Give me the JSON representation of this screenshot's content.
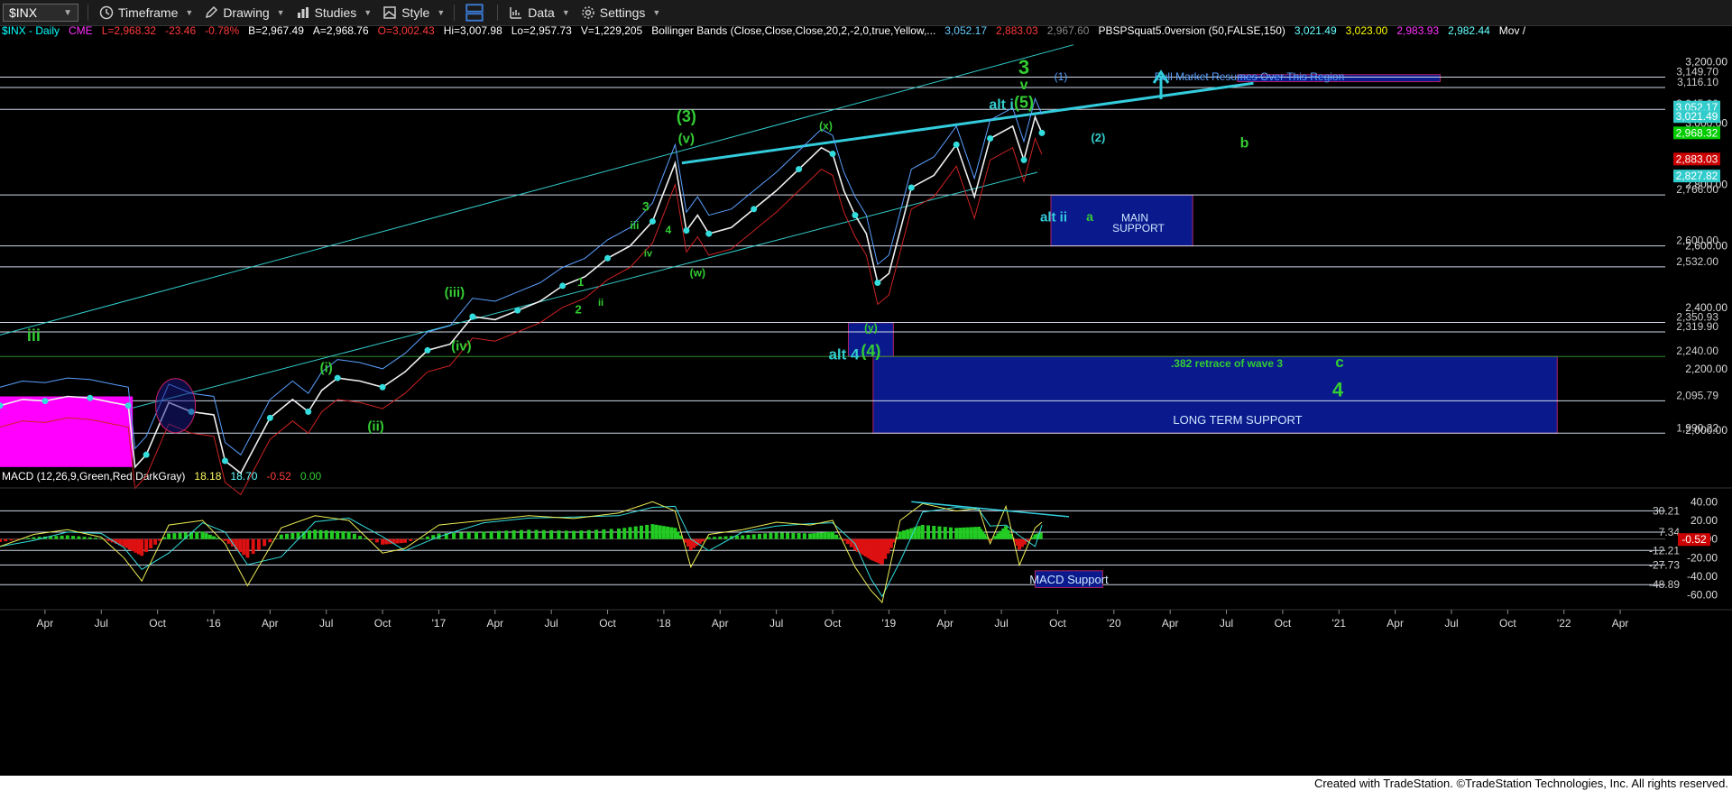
{
  "toolbar": {
    "symbol": "$INX",
    "items": [
      "Timeframe",
      "Drawing",
      "Studies",
      "Style",
      "Data",
      "Settings"
    ]
  },
  "header": {
    "main": [
      {
        "t": "$INX - Daily",
        "c": "#00ffff"
      },
      {
        "t": "CME",
        "c": "#ff33ff"
      },
      {
        "t": "L=2,968.32",
        "c": "#ff3b3b"
      },
      {
        "t": "-23.46",
        "c": "#ff3b3b"
      },
      {
        "t": "-0.78%",
        "c": "#ff3b3b"
      },
      {
        "t": "B=2,967.49",
        "c": "#ffffff"
      },
      {
        "t": "A=2,968.76",
        "c": "#ffffff"
      },
      {
        "t": "O=3,002.43",
        "c": "#ff3b3b"
      },
      {
        "t": "Hi=3,007.98",
        "c": "#ffffff"
      },
      {
        "t": "Lo=2,957.73",
        "c": "#ffffff"
      },
      {
        "t": "V=1,229,205",
        "c": "#ffffff"
      },
      {
        "t": "Bollinger Bands (Close,Close,Close,20,2,-2,0,true,Yellow,...",
        "c": "#ffffff"
      },
      {
        "t": "3,052.17",
        "c": "#66ccff"
      },
      {
        "t": "2,883.03",
        "c": "#ff3b3b"
      },
      {
        "t": "2,967.60",
        "c": "#888888"
      },
      {
        "t": "PBSPSquat5.0version (50,FALSE,150)",
        "c": "#ffffff"
      },
      {
        "t": "3,021.49",
        "c": "#66ffff"
      },
      {
        "t": "3,023.00",
        "c": "#ffff00"
      },
      {
        "t": "2,983.93",
        "c": "#ff33ff"
      },
      {
        "t": "2,982.44",
        "c": "#66ffff"
      },
      {
        "t": "Mov /",
        "c": "#ffffff"
      }
    ],
    "macd": [
      {
        "t": "MACD (12,26,9,Green,Red,DarkGray)",
        "c": "#ffffff"
      },
      {
        "t": "18.18",
        "c": "#ffff66"
      },
      {
        "t": "18.70",
        "c": "#66ffff"
      },
      {
        "t": "-0.52",
        "c": "#ff3b3b"
      },
      {
        "t": "0.00",
        "c": "#33cc33"
      }
    ]
  },
  "chart_data": [
    {
      "type": "line",
      "name": "$INX - Daily",
      "ylim": [
        1850,
        3260
      ],
      "y_ticks": [
        2000,
        2200,
        2400,
        2600,
        2800,
        3000,
        3200
      ],
      "y_tick_labels": [
        "2,000.00",
        "2,200.00",
        "2,400.00",
        "2,600.00",
        "2,800.00",
        "3,000.00",
        "3,200.00"
      ],
      "x_tick_labels": [
        "Apr",
        "Jul",
        "Oct",
        "'16",
        "Apr",
        "Jul",
        "Oct",
        "'17",
        "Apr",
        "Jul",
        "Oct",
        "'18",
        "Apr",
        "Jul",
        "Oct",
        "'19",
        "Apr",
        "Jul",
        "Oct",
        "'20",
        "Apr",
        "Jul",
        "Oct",
        "'21",
        "Apr",
        "Jul",
        "Oct",
        "'22",
        "Apr"
      ],
      "x_tick_times": [
        2015.25,
        2015.5,
        2015.75,
        2016.0,
        2016.25,
        2016.5,
        2016.75,
        2017.0,
        2017.25,
        2017.5,
        2017.75,
        2018.0,
        2018.25,
        2018.5,
        2018.75,
        2019.0,
        2019.25,
        2019.5,
        2019.75,
        2020.0,
        2020.25,
        2020.5,
        2020.75,
        2021.0,
        2021.25,
        2021.5,
        2021.75,
        2022.0,
        2022.25
      ],
      "x_range": [
        2015.05,
        2022.45
      ],
      "price_series": {
        "x": [
          2015.05,
          2015.15,
          2015.25,
          2015.35,
          2015.45,
          2015.55,
          2015.62,
          2015.65,
          2015.7,
          2015.8,
          2015.9,
          2016.0,
          2016.05,
          2016.12,
          2016.25,
          2016.35,
          2016.42,
          2016.48,
          2016.55,
          2016.65,
          2016.75,
          2016.85,
          2016.95,
          2017.05,
          2017.15,
          2017.25,
          2017.35,
          2017.45,
          2017.55,
          2017.65,
          2017.75,
          2017.85,
          2017.95,
          2018.05,
          2018.1,
          2018.15,
          2018.2,
          2018.3,
          2018.4,
          2018.5,
          2018.6,
          2018.7,
          2018.75,
          2018.8,
          2018.85,
          2018.9,
          2018.95,
          2019.0,
          2019.1,
          2019.2,
          2019.3,
          2019.38,
          2019.45,
          2019.55,
          2019.6,
          2019.65,
          2019.68
        ],
        "y": [
          2080,
          2100,
          2095,
          2110,
          2105,
          2090,
          2080,
          1880,
          1920,
          2090,
          2060,
          2050,
          1900,
          1860,
          2040,
          2100,
          2060,
          2130,
          2170,
          2160,
          2140,
          2190,
          2260,
          2280,
          2370,
          2360,
          2390,
          2420,
          2470,
          2500,
          2560,
          2600,
          2680,
          2870,
          2650,
          2700,
          2640,
          2660,
          2720,
          2780,
          2850,
          2920,
          2900,
          2780,
          2700,
          2640,
          2480,
          2510,
          2790,
          2830,
          2930,
          2760,
          2950,
          2990,
          2880,
          3020,
          2968
        ]
      },
      "horizontal_levels": [
        {
          "value": 3149.7,
          "label": "3,149.70"
        },
        {
          "value": 3116.1,
          "label": "3,116.10"
        },
        {
          "value": 3045.0,
          "label": "3,045.00"
        },
        {
          "value": 2766.0,
          "label": "2,766.00"
        },
        {
          "value": 2600.0,
          "label": "2,600.00"
        },
        {
          "value": 2532.0,
          "label": "2,532.00"
        },
        {
          "value": 2350.93,
          "label": "2,350.93"
        },
        {
          "value": 2319.9,
          "label": "2,319.90"
        },
        {
          "value": 2240.0,
          "label": "2,240.00"
        },
        {
          "value": 2095.79,
          "label": "2,095.79"
        },
        {
          "value": 1990.22,
          "label": "1,990.22"
        }
      ],
      "price_tags": [
        {
          "value": 3052.17,
          "label": "3,052.17",
          "color": "#33cccc"
        },
        {
          "value": 3021.49,
          "label": "3,021.49",
          "color": "#33cccc"
        },
        {
          "value": 2968.32,
          "label": "2,968.32",
          "color": "#00cc00"
        },
        {
          "value": 2883.03,
          "label": "2,883.03",
          "color": "#cc0000"
        },
        {
          "value": 2827.82,
          "label": "2,827.82",
          "color": "#33cccc"
        }
      ],
      "zones": [
        {
          "x0": 2019.72,
          "x1": 2020.35,
          "y0": 2600,
          "y1": 2766,
          "texts": [
            "alt ii",
            "a",
            "MAIN",
            "SUPPORT"
          ]
        },
        {
          "x0": 2018.93,
          "x1": 2021.97,
          "y0": 1990,
          "y1": 2240,
          "texts": [
            ".382 retrace of wave 3",
            "c",
            "4",
            "LONG TERM SUPPORT"
          ]
        },
        {
          "x0": 2018.82,
          "x1": 2019.02,
          "y0": 2240,
          "y1": 2350,
          "texts": []
        },
        {
          "x0": 2020.55,
          "x1": 2021.45,
          "y0": 3135,
          "y1": 3158,
          "texts": [
            "(1)",
            "Bull Market Resumes Over This Region"
          ]
        }
      ],
      "annotations": [
        {
          "text": "iii",
          "x": 2015.2,
          "y": 2290,
          "color": "#33cc33",
          "size": 18
        },
        {
          "text": "(i)",
          "x": 2016.5,
          "y": 2190,
          "color": "#33cc33",
          "size": 15
        },
        {
          "text": "(ii)",
          "x": 2016.72,
          "y": 1998,
          "color": "#33cc33",
          "size": 15
        },
        {
          "text": "(iii)",
          "x": 2017.07,
          "y": 2435,
          "color": "#33cc33",
          "size": 15
        },
        {
          "text": "(iv)",
          "x": 2017.1,
          "y": 2260,
          "color": "#33cc33",
          "size": 15
        },
        {
          "text": "3",
          "x": 2017.92,
          "y": 2715,
          "color": "#33cc33",
          "size": 14
        },
        {
          "text": "iii",
          "x": 2017.87,
          "y": 2655,
          "color": "#33cc33",
          "size": 12
        },
        {
          "text": "4",
          "x": 2018.02,
          "y": 2640,
          "color": "#33cc33",
          "size": 12
        },
        {
          "text": "iv",
          "x": 2017.93,
          "y": 2565,
          "color": "#33cc33",
          "size": 11
        },
        {
          "text": "1",
          "x": 2017.63,
          "y": 2470,
          "color": "#33cc33",
          "size": 13
        },
        {
          "text": "2",
          "x": 2017.62,
          "y": 2380,
          "color": "#33cc33",
          "size": 13
        },
        {
          "text": "ii",
          "x": 2017.72,
          "y": 2405,
          "color": "#33cc33",
          "size": 11
        },
        {
          "text": "(3)",
          "x": 2018.1,
          "y": 3005,
          "color": "#33cc33",
          "size": 18
        },
        {
          "text": "(v)",
          "x": 2018.1,
          "y": 2935,
          "color": "#33cc33",
          "size": 15
        },
        {
          "text": "(w)",
          "x": 2018.15,
          "y": 2500,
          "color": "#33cc33",
          "size": 12
        },
        {
          "text": "(x)",
          "x": 2018.72,
          "y": 2980,
          "color": "#33cc33",
          "size": 12
        },
        {
          "text": "(y)",
          "x": 2018.92,
          "y": 2322,
          "color": "#33cc33",
          "size": 12
        },
        {
          "text": "alt 4",
          "x": 2018.8,
          "y": 2230,
          "color": "#33cccc",
          "size": 17
        },
        {
          "text": "(4)",
          "x": 2018.92,
          "y": 2240,
          "color": "#33cc33",
          "size": 18
        },
        {
          "text": "alt i",
          "x": 2019.5,
          "y": 3045,
          "color": "#33cccc",
          "size": 16
        },
        {
          "text": "(5)",
          "x": 2019.6,
          "y": 3050,
          "color": "#33cc33",
          "size": 18
        },
        {
          "text": "v",
          "x": 2019.6,
          "y": 3110,
          "color": "#33cc33",
          "size": 16
        },
        {
          "text": "3",
          "x": 2019.6,
          "y": 3160,
          "color": "#33cc33",
          "size": 22
        },
        {
          "text": "(2)",
          "x": 2019.93,
          "y": 2940,
          "color": "#33cccc",
          "size": 13
        },
        {
          "text": "b",
          "x": 2020.58,
          "y": 2920,
          "color": "#33cc33",
          "size": 16
        }
      ]
    },
    {
      "type": "line",
      "name": "MACD (12,26,9,Green,Red,DarkGray)",
      "ylim": [
        -68,
        48
      ],
      "y_ticks": [
        40,
        20,
        0,
        -20,
        -40,
        -60
      ],
      "y_tick_labels": [
        "40.00",
        "20.00",
        "0.00",
        "-20.00",
        "-40.00",
        "-60.00"
      ],
      "horizontal_levels": [
        {
          "value": 30.21,
          "label": "30.21"
        },
        {
          "value": 7.34,
          "label": "7.34"
        },
        {
          "value": -12.21,
          "label": "-12.21"
        },
        {
          "value": -27.73,
          "label": "-27.73"
        },
        {
          "value": -48.89,
          "label": "-48.89"
        }
      ],
      "price_tags": [
        {
          "value": -0.52,
          "label": "-0.52",
          "color": "#cc0000"
        }
      ],
      "macd_series": {
        "x": [
          2015.05,
          2015.2,
          2015.35,
          2015.5,
          2015.6,
          2015.68,
          2015.8,
          2015.95,
          2016.05,
          2016.15,
          2016.3,
          2016.45,
          2016.6,
          2016.75,
          2016.85,
          2017.0,
          2017.2,
          2017.4,
          2017.6,
          2017.8,
          2017.95,
          2018.05,
          2018.12,
          2018.2,
          2018.35,
          2018.5,
          2018.65,
          2018.75,
          2018.85,
          2018.92,
          2018.97,
          2019.05,
          2019.15,
          2019.3,
          2019.4,
          2019.45,
          2019.52,
          2019.58,
          2019.65,
          2019.68
        ],
        "y": [
          -8,
          5,
          10,
          2,
          -20,
          -45,
          15,
          20,
          -5,
          -50,
          12,
          25,
          20,
          -15,
          -10,
          15,
          20,
          25,
          22,
          28,
          40,
          30,
          -30,
          5,
          10,
          18,
          15,
          20,
          -30,
          -55,
          -68,
          20,
          38,
          30,
          33,
          -5,
          35,
          -28,
          12,
          18
        ]
      },
      "zone": {
        "x0": 2019.65,
        "x1": 2019.95,
        "y0": -52,
        "y1": -34,
        "texts": [
          "MACD Support"
        ]
      }
    }
  ],
  "footer": "Created with TradeStation. ©TradeStation Technologies, Inc. All rights reserved."
}
